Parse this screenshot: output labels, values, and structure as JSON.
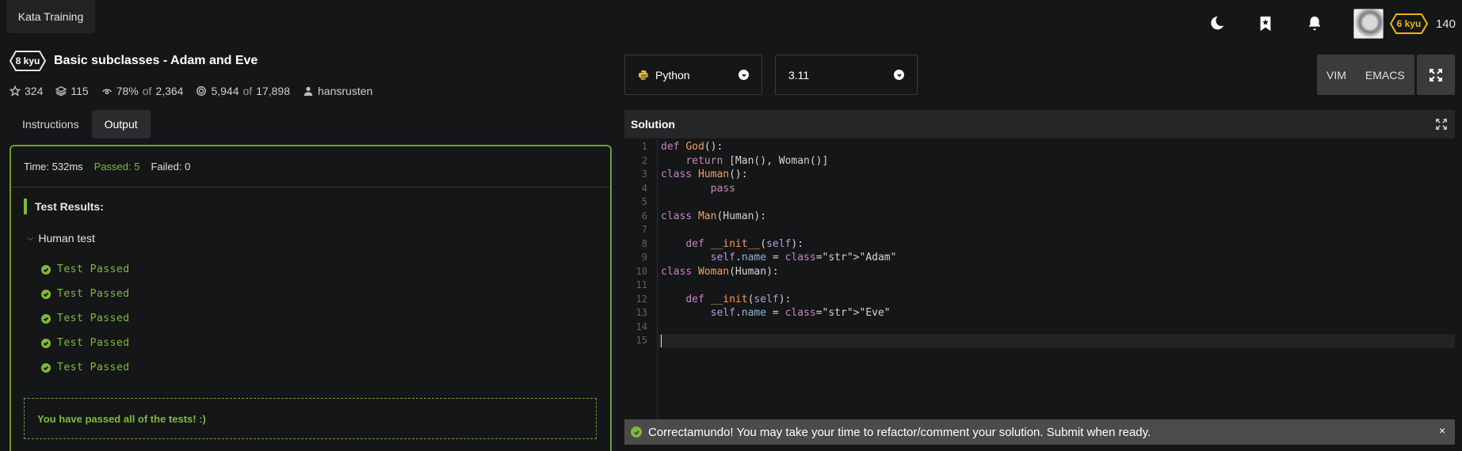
{
  "app": {
    "tab_label": "Kata Training"
  },
  "header": {
    "icons": [
      "moon-icon",
      "bookmark-icon",
      "bell-icon"
    ],
    "user": {
      "rank": "6 kyu",
      "honor": "140"
    }
  },
  "kata": {
    "rank": "8 kyu",
    "title": "Basic subclasses - Adam and Eve",
    "stars": "324",
    "collections": "115",
    "satisfaction": "78%",
    "satisfaction_of": "of",
    "satisfaction_total": "2,364",
    "completed": "5,944",
    "completed_of": "of",
    "completed_total": "17,898",
    "author": "hansrusten"
  },
  "tabs": [
    {
      "label": "Instructions",
      "active": false
    },
    {
      "label": "Output",
      "active": true
    }
  ],
  "output": {
    "time": "Time: 532ms",
    "passed": "Passed: 5",
    "failed": "Failed: 0",
    "results_heading": "Test Results:",
    "group": "Human test",
    "tests": [
      "Test Passed",
      "Test Passed",
      "Test Passed",
      "Test Passed",
      "Test Passed"
    ],
    "success_message": "You have passed all of the tests! :)"
  },
  "editor_bar": {
    "language": "Python",
    "version": "3.11",
    "modes": [
      "VIM",
      "EMACS"
    ]
  },
  "solution": {
    "title": "Solution",
    "line_numbers": [
      "1",
      "2",
      "3",
      "4",
      "5",
      "6",
      "7",
      "8",
      "9",
      "10",
      "11",
      "12",
      "13",
      "14",
      "15"
    ],
    "code": [
      "def God():",
      "    return [Man(), Woman()]",
      "class Human():",
      "        pass",
      "",
      "class Man(Human):",
      "",
      "    def __init__(self):",
      "        self.name = \"Adam\"",
      "class Woman(Human):",
      "",
      "    def __init(self):",
      "        self.name = \"Eve\"",
      "",
      ""
    ]
  },
  "toast": {
    "message": "Correctamundo! You may take your time to refactor/comment your solution. Submit when ready.",
    "close": "×"
  },
  "colors": {
    "success": "#7fba3a",
    "rank_yellow": "#ecb613",
    "background": "#151617"
  }
}
